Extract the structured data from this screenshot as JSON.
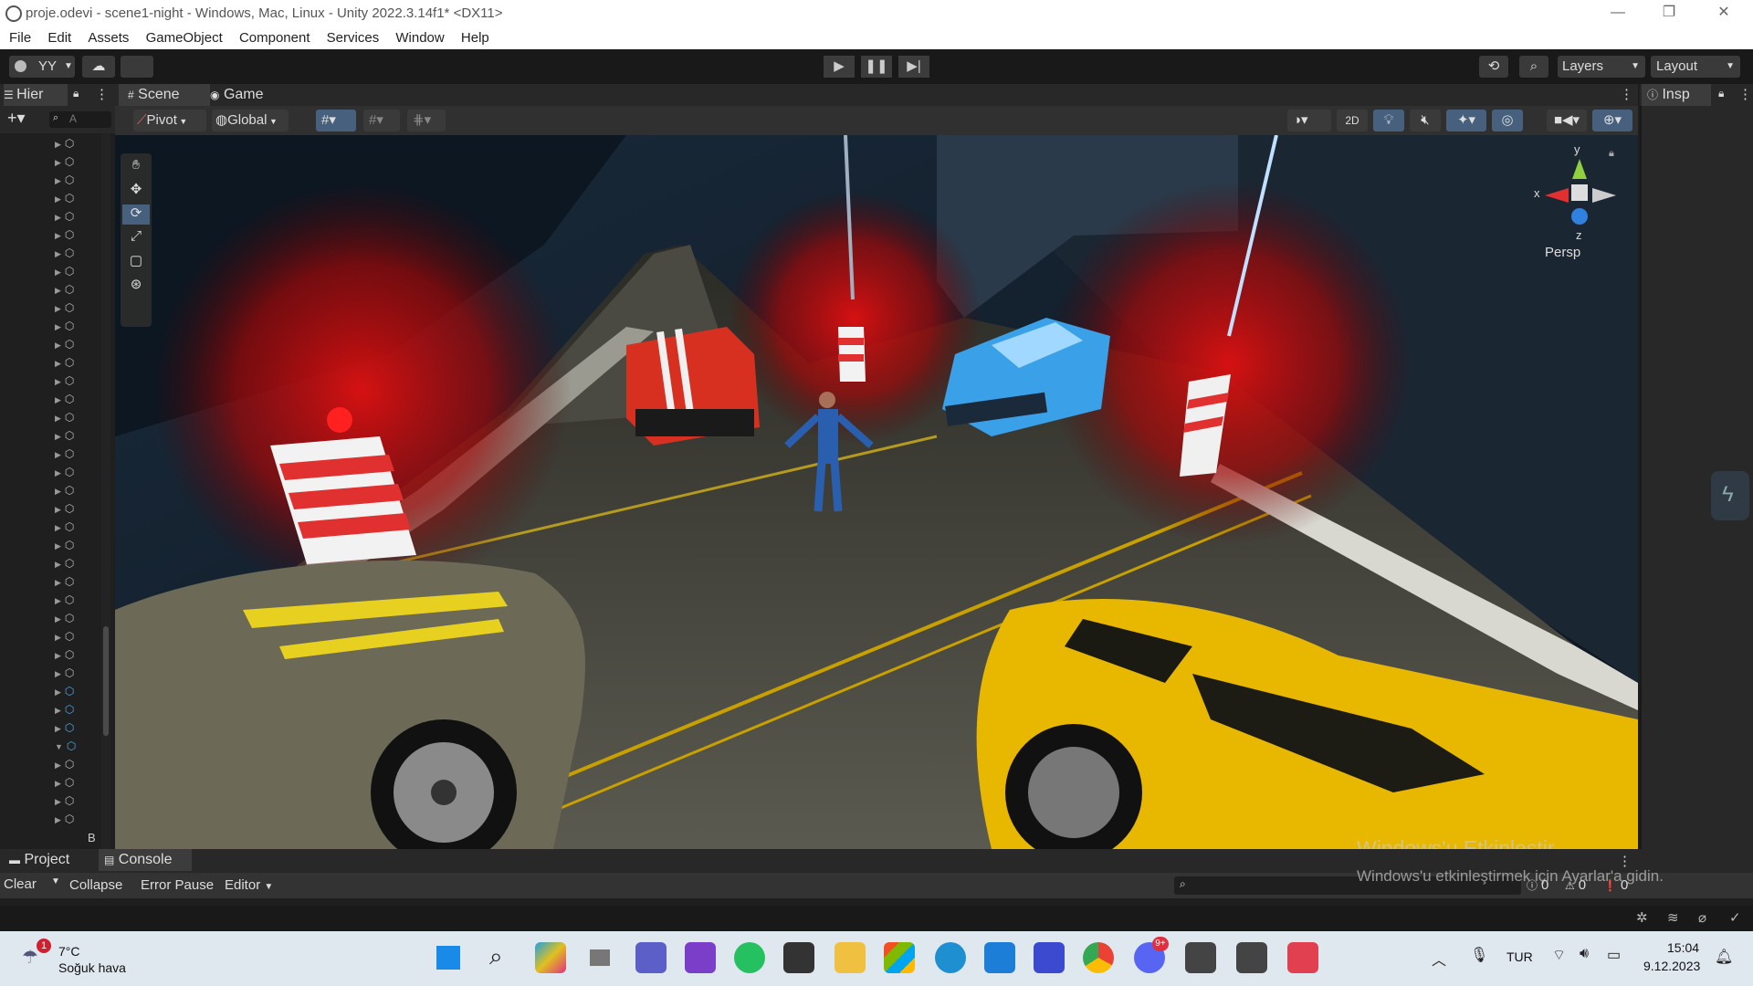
{
  "window": {
    "title": "proje.odevi - scene1-night - Windows, Mac, Linux - Unity 2022.3.14f1* <DX11>",
    "minimize": "—",
    "restore": "❐",
    "close": "✕"
  },
  "menu": [
    "File",
    "Edit",
    "Assets",
    "GameObject",
    "Component",
    "Services",
    "Window",
    "Help"
  ],
  "toolbar": {
    "account": "YY",
    "layers": "Layers",
    "layout": "Layout"
  },
  "hierarchy": {
    "tab": "Hier",
    "search_placeholder": "A",
    "last_item": "B"
  },
  "scene": {
    "tab_scene": "Scene",
    "tab_game": "Game",
    "pivot": "Pivot",
    "global": "Global",
    "mode_2d": "2D",
    "gizmo_x": "x",
    "gizmo_y": "y",
    "gizmo_z": "z",
    "persp": "Persp"
  },
  "inspector": {
    "tab": "Insp"
  },
  "console": {
    "tab_project": "Project",
    "tab_console": "Console",
    "clear": "Clear",
    "collapse": "Collapse",
    "error_pause": "Error Pause",
    "editor": "Editor",
    "count_logs": "0",
    "count_warnings": "0",
    "count_errors": "0"
  },
  "watermark": {
    "line1": "Windows'u Etkinleştir",
    "line2": "Windows'u etkinleştirmek için Ayarlar'a gidin."
  },
  "taskbar": {
    "weather_temp": "7°C",
    "weather_desc": "Soğuk hava",
    "weather_badge": "1",
    "discord_badge": "9+",
    "language": "TUR",
    "time": "15:04",
    "date": "9.12.2023"
  },
  "colors": {
    "editor_bg": "#1e1e1e",
    "panel": "#282828",
    "taskbar": "#dfe7ef",
    "red_glow": "#e01010",
    "yellow_car": "#f0c000"
  }
}
